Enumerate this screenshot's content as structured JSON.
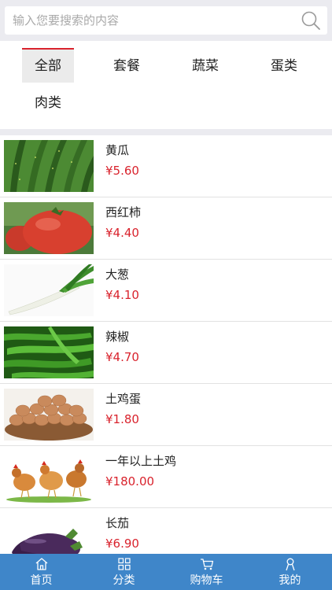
{
  "search": {
    "placeholder": "输入您要搜索的内容",
    "icon": "search-icon"
  },
  "categories": [
    {
      "label": "全部",
      "active": true
    },
    {
      "label": "套餐",
      "active": false
    },
    {
      "label": "蔬菜",
      "active": false
    },
    {
      "label": "蛋类",
      "active": false
    },
    {
      "label": "肉类",
      "active": false
    }
  ],
  "products": [
    {
      "name": "黄瓜",
      "price": "¥5.60",
      "image": "cucumber"
    },
    {
      "name": "西红柿",
      "price": "¥4.40",
      "image": "tomato"
    },
    {
      "name": "大葱",
      "price": "¥4.10",
      "image": "scallion"
    },
    {
      "name": "辣椒",
      "price": "¥4.70",
      "image": "green-pepper"
    },
    {
      "name": "土鸡蛋",
      "price": "¥1.80",
      "image": "eggs"
    },
    {
      "name": "一年以上土鸡",
      "price": "¥180.00",
      "image": "chicken"
    },
    {
      "name": "长茄",
      "price": "¥6.90",
      "image": "eggplant"
    }
  ],
  "tabbar": {
    "items": [
      {
        "label": "首页",
        "icon": "home-icon"
      },
      {
        "label": "分类",
        "icon": "grid-icon"
      },
      {
        "label": "购物车",
        "icon": "cart-icon"
      },
      {
        "label": "我的",
        "icon": "user-icon"
      }
    ]
  },
  "colors": {
    "accent": "#d9232d",
    "tabbar": "#3f86c9",
    "background": "#ebebf0"
  }
}
